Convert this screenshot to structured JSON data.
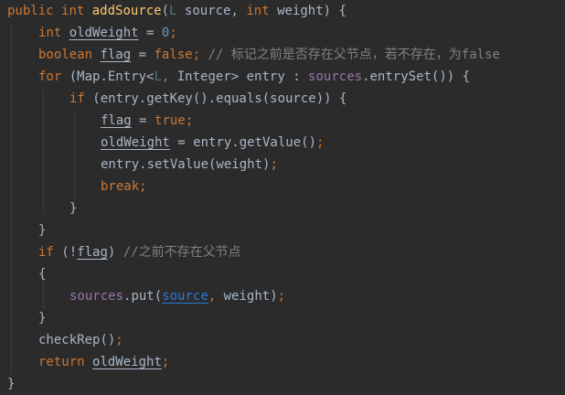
{
  "editor": {
    "colors": {
      "background": "#2b2b2b",
      "keyword": "#cc7832",
      "function": "#ffc66d",
      "plain": "#a9b7c6",
      "field": "#9876aa",
      "number": "#6897bb",
      "comment": "#808080",
      "type_param": "#507874",
      "param_ref": "#287bde"
    },
    "lines": [
      [
        [
          "kw",
          "public"
        ],
        [
          "pl",
          " "
        ],
        [
          "kw",
          "int"
        ],
        [
          "pl",
          " "
        ],
        [
          "fn",
          "addSource"
        ],
        [
          "pl",
          "("
        ],
        [
          "tp",
          "L"
        ],
        [
          "pl",
          " source, "
        ],
        [
          "kw",
          "int"
        ],
        [
          "pl",
          " weight) {"
        ]
      ],
      [
        [
          "kw",
          "int"
        ],
        [
          "pl",
          " "
        ],
        [
          "var",
          "oldWeight"
        ],
        [
          "pl",
          " = "
        ],
        [
          "num",
          "0"
        ],
        [
          "kw",
          ";"
        ]
      ],
      [
        [
          "kw",
          "boolean"
        ],
        [
          "pl",
          " "
        ],
        [
          "var",
          "flag"
        ],
        [
          "pl",
          " = "
        ],
        [
          "kw",
          "false"
        ],
        [
          "kw",
          ";"
        ],
        [
          "pl",
          " "
        ],
        [
          "cmt",
          "// 标记之前是否存在父节点，若不存在，为false"
        ]
      ],
      [
        [
          "kw",
          "for"
        ],
        [
          "pl",
          " (Map.Entry<"
        ],
        [
          "tp",
          "L"
        ],
        [
          "kw",
          ","
        ],
        [
          "pl",
          " Integer> entry : "
        ],
        [
          "field",
          "sources"
        ],
        [
          "pl",
          ".entrySet()) {"
        ]
      ],
      [
        [
          "kw",
          "if"
        ],
        [
          "pl",
          " (entry.getKey().equals(source)) {"
        ]
      ],
      [
        [
          "var",
          "flag"
        ],
        [
          "pl",
          " = "
        ],
        [
          "kw",
          "true"
        ],
        [
          "kw",
          ";"
        ]
      ],
      [
        [
          "var",
          "oldWeight"
        ],
        [
          "pl",
          " = entry.getValue()"
        ],
        [
          "kw",
          ";"
        ]
      ],
      [
        [
          "pl",
          "entry.setValue(weight)"
        ],
        [
          "kw",
          ";"
        ]
      ],
      [
        [
          "kw",
          "break"
        ],
        [
          "kw",
          ";"
        ]
      ],
      [
        [
          "pl",
          "}"
        ]
      ],
      [
        [
          "pl",
          "}"
        ]
      ],
      [
        [
          "kw",
          "if"
        ],
        [
          "pl",
          " (!"
        ],
        [
          "var",
          "flag"
        ],
        [
          "pl",
          ") "
        ],
        [
          "cmt",
          "//之前不存在父节点"
        ]
      ],
      [
        [
          "pl",
          "{"
        ]
      ],
      [
        [
          "field",
          "sources"
        ],
        [
          "pl",
          ".put("
        ],
        [
          "var-blue",
          "source"
        ],
        [
          "kw",
          ","
        ],
        [
          "pl",
          " weight)"
        ],
        [
          "kw",
          ";"
        ]
      ],
      [
        [
          "pl",
          "}"
        ]
      ],
      [
        [
          "pl",
          "checkRep()"
        ],
        [
          "kw",
          ";"
        ]
      ],
      [
        [
          "kw",
          "return"
        ],
        [
          "pl",
          " "
        ],
        [
          "var",
          "oldWeight"
        ],
        [
          "kw",
          ";"
        ]
      ],
      [
        [
          "pl",
          "}"
        ]
      ]
    ]
  }
}
